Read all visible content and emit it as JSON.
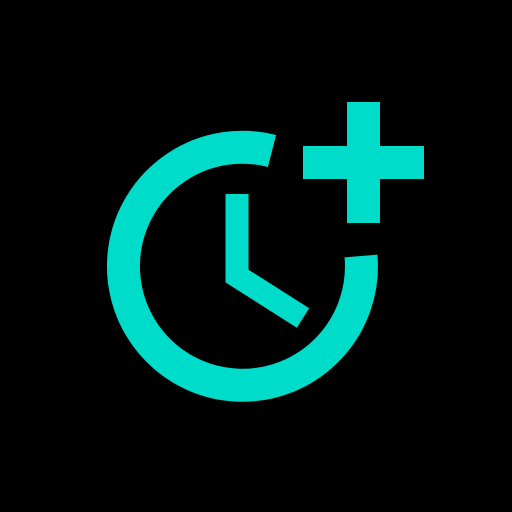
{
  "icon": {
    "name": "add-alarm-icon",
    "color": "#00DCCA",
    "background": "#000000"
  }
}
